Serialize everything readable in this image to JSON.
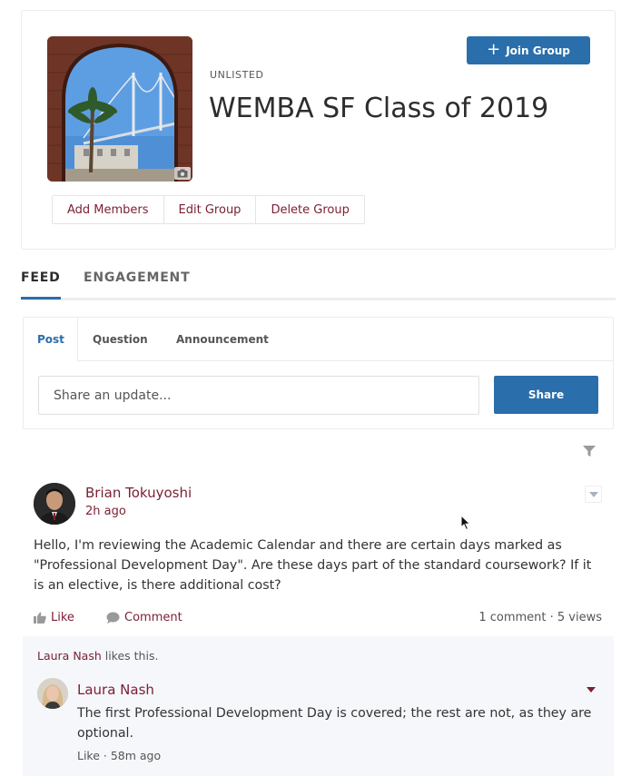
{
  "group": {
    "visibility": "UNLISTED",
    "title": "WEMBA SF Class of 2019",
    "join_label": "Join Group",
    "photo_icon": "camera-icon",
    "actions": [
      "Add Members",
      "Edit Group",
      "Delete Group"
    ]
  },
  "tabs": {
    "feed": "FEED",
    "engagement": "ENGAGEMENT",
    "active": "FEED"
  },
  "composer": {
    "tabs": [
      "Post",
      "Question",
      "Announcement"
    ],
    "active_tab": "Post",
    "placeholder": "Share an update...",
    "share_label": "Share"
  },
  "post": {
    "author": "Brian Tokuyoshi",
    "time": "2h ago",
    "body": "Hello, I'm reviewing the Academic Calendar and there are certain days marked as \"Professional Development Day\".  Are these days part of the standard coursework? If it is an elective, is there additional cost?",
    "like_label": "Like",
    "comment_label": "Comment",
    "stats": "1 comment · 5 views"
  },
  "comments": {
    "likes_who": "Laura Nash",
    "likes_suffix": " likes this.",
    "items": [
      {
        "author": "Laura Nash",
        "body": "The first Professional Development Day is covered; the rest are not, as they are optional.",
        "meta": "Like · 58m ago"
      }
    ]
  },
  "colors": {
    "brand_blue": "#2a6eab",
    "link_maroon": "#7a1f33",
    "comment_bg": "#f5f7fa"
  }
}
